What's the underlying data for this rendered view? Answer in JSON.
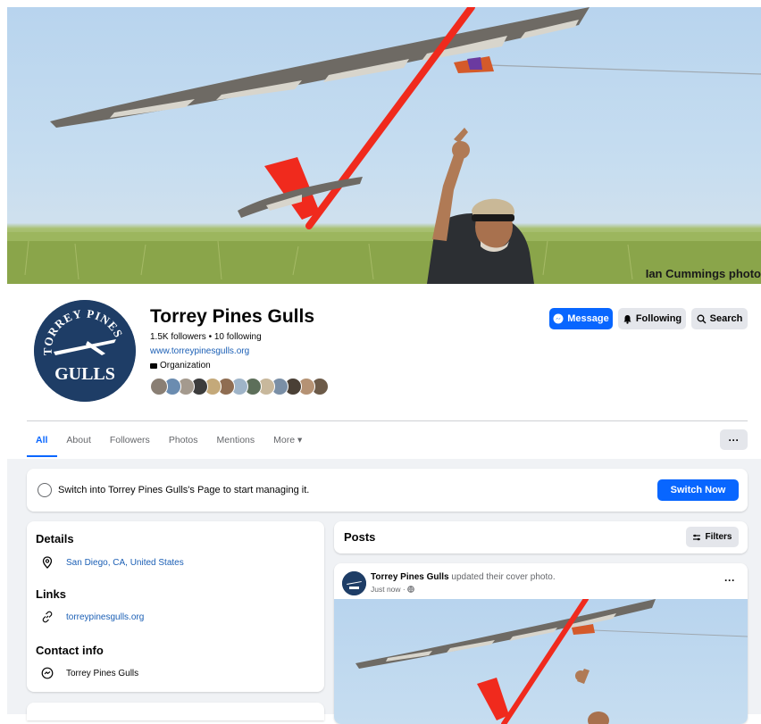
{
  "cover": {
    "credit": "Ian Cummings photo"
  },
  "profile": {
    "name": "Torrey Pines Gulls",
    "stats": "1.5K followers • 10 following",
    "website": "www.torreypinesgulls.org",
    "category": "Organization",
    "logo_text_top": "TORREY PINES",
    "logo_text_bottom": "GULLS",
    "follower_avatar_colors": [
      "#8a7f74",
      "#6b8cb0",
      "#a49a8e",
      "#3c3c3c",
      "#c4a97a",
      "#8f6d52",
      "#9fb4c8",
      "#5d6f5a",
      "#c8b89c",
      "#7a8fa6",
      "#4a4036",
      "#b59274",
      "#6c5a48"
    ]
  },
  "actions": {
    "message": "Message",
    "following": "Following",
    "search": "Search"
  },
  "tabs": [
    {
      "label": "All",
      "active": true
    },
    {
      "label": "About"
    },
    {
      "label": "Followers"
    },
    {
      "label": "Photos"
    },
    {
      "label": "Mentions"
    },
    {
      "label": "More ▾"
    }
  ],
  "tab_more_button": "···",
  "switch": {
    "text": "Switch into Torrey Pines Gulls's Page to start managing it.",
    "button": "Switch Now"
  },
  "intro": {
    "details_heading": "Details",
    "location": "San Diego, CA, United States",
    "links_heading": "Links",
    "link": "torreypinesgulls.org",
    "contact_heading": "Contact info",
    "contact": "Torrey Pines Gulls"
  },
  "posts": {
    "heading": "Posts",
    "filters": "Filters",
    "post": {
      "author": "Torrey Pines Gulls",
      "action": " updated their cover photo.",
      "time": "Just now · ",
      "more": "···"
    }
  },
  "colors": {
    "brand_blue": "#0866ff",
    "link_blue": "#1b5fb5",
    "logo_navy": "#1e3d66",
    "glider_red": "#f02a1d",
    "bg_grey": "#f0f2f5"
  }
}
